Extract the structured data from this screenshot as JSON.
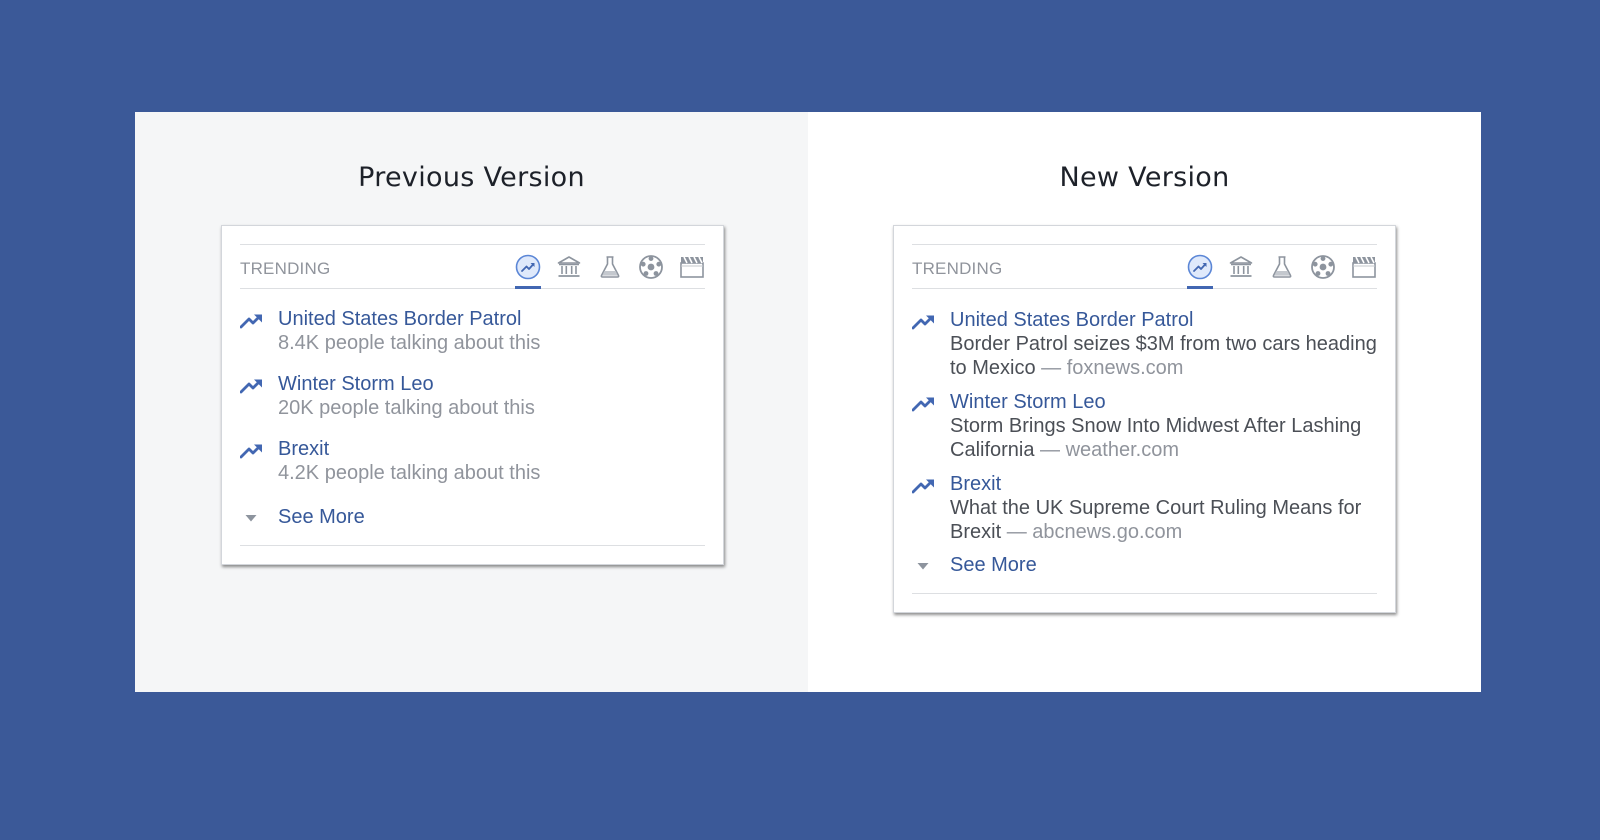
{
  "previous": {
    "heading": "Previous Version",
    "card": {
      "header_label": "TRENDING",
      "categories": [
        {
          "icon": "trending-icon",
          "active": true
        },
        {
          "icon": "politics-icon",
          "active": false
        },
        {
          "icon": "science-icon",
          "active": false
        },
        {
          "icon": "sports-icon",
          "active": false
        },
        {
          "icon": "entertainment-icon",
          "active": false
        }
      ],
      "topics": [
        {
          "title": "United States Border Patrol",
          "subtitle": "8.4K people talking about this"
        },
        {
          "title": "Winter Storm Leo",
          "subtitle": "20K people talking about this"
        },
        {
          "title": "Brexit",
          "subtitle": "4.2K people talking about this"
        }
      ],
      "see_more": "See More"
    }
  },
  "new": {
    "heading": "New Version",
    "card": {
      "header_label": "TRENDING",
      "categories": [
        {
          "icon": "trending-icon",
          "active": true
        },
        {
          "icon": "politics-icon",
          "active": false
        },
        {
          "icon": "science-icon",
          "active": false
        },
        {
          "icon": "sports-icon",
          "active": false
        },
        {
          "icon": "entertainment-icon",
          "active": false
        }
      ],
      "topics": [
        {
          "title": "United States Border Patrol",
          "description": "Border Patrol seizes $3M from two cars heading to Mexico",
          "separator": "—",
          "source": "foxnews.com"
        },
        {
          "title": "Winter Storm Leo",
          "description": "Storm Brings Snow Into Midwest After Lashing California",
          "separator": "—",
          "source": "weather.com"
        },
        {
          "title": "Brexit",
          "description": "What the UK Supreme Court Ruling Means for Brexit",
          "separator": "—",
          "source": "abcnews.go.com"
        }
      ],
      "see_more": "See More"
    }
  },
  "colors": {
    "page_background": "#3b5998",
    "link_blue": "#365899",
    "accent_blue": "#4267b2",
    "muted_gray": "#90949c"
  }
}
